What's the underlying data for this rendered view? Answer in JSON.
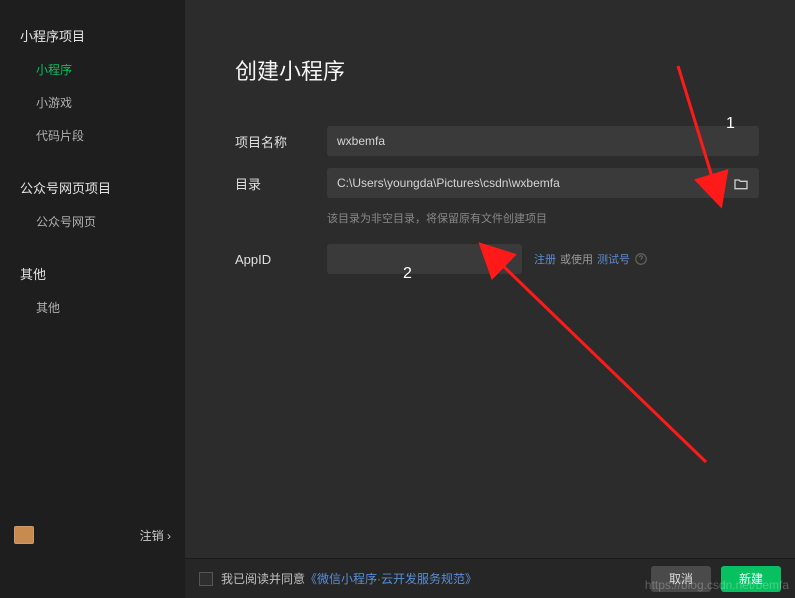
{
  "sidebar": {
    "groups": [
      {
        "title": "小程序项目",
        "items": [
          {
            "label": "小程序",
            "active": true
          },
          {
            "label": "小游戏",
            "active": false
          },
          {
            "label": "代码片段",
            "active": false
          }
        ]
      },
      {
        "title": "公众号网页项目",
        "items": [
          {
            "label": "公众号网页",
            "active": false
          }
        ]
      },
      {
        "title": "其他",
        "items": [
          {
            "label": "其他",
            "active": false
          }
        ]
      }
    ],
    "logout": "注销 ›"
  },
  "main": {
    "title": "创建小程序",
    "form": {
      "project_name": {
        "label": "项目名称",
        "value": "wxbemfa"
      },
      "directory": {
        "label": "目录",
        "value": "C:\\Users\\youngda\\Pictures\\csdn\\wxbemfa",
        "hint": "该目录为非空目录，将保留原有文件创建项目"
      },
      "appid": {
        "label": "AppID",
        "value": "",
        "register": "注册",
        "or_use": "或使用",
        "test_id": "测试号"
      }
    }
  },
  "footer": {
    "agree_prefix": "我已阅读并同意",
    "agree_link": "《微信小程序·云开发服务规范》",
    "cancel": "取消",
    "create": "新建"
  },
  "annotations": {
    "num1": "1",
    "num2": "2"
  },
  "watermark": "https://blog.csdn.net/bemfa"
}
